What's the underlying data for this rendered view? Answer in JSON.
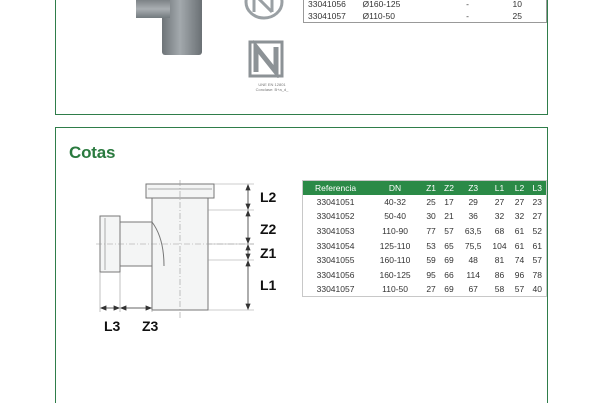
{
  "top_table": {
    "rows": [
      {
        "ref": "33041056",
        "dn": "Ø160-125",
        "col3": "-",
        "col4": "10"
      },
      {
        "ref": "33041057",
        "dn": "Ø110-50",
        "col3": "-",
        "col4": "25"
      }
    ]
  },
  "certification": {
    "caption_line1": "UNE EN 12801",
    "caption_line2": "Conclase: B+a_d_"
  },
  "cotas": {
    "title": "Cotas",
    "drawing_labels": {
      "l2": "L2",
      "z2": "Z2",
      "z1": "Z1",
      "l1": "L1",
      "l3": "L3",
      "z3": "Z3"
    },
    "table": {
      "headers": [
        "Referencia",
        "DN",
        "Z1",
        "Z2",
        "Z3",
        "L1",
        "L2",
        "L3"
      ],
      "rows": [
        [
          "33041051",
          "40-32",
          "25",
          "17",
          "29",
          "27",
          "27",
          "23"
        ],
        [
          "33041052",
          "50-40",
          "30",
          "21",
          "36",
          "32",
          "32",
          "27"
        ],
        [
          "33041053",
          "110-90",
          "77",
          "57",
          "63,5",
          "68",
          "61",
          "52"
        ],
        [
          "33041054",
          "125-110",
          "53",
          "65",
          "75,5",
          "104",
          "61",
          "61"
        ],
        [
          "33041055",
          "160-110",
          "59",
          "69",
          "48",
          "81",
          "74",
          "57"
        ],
        [
          "33041056",
          "160-125",
          "95",
          "66",
          "114",
          "86",
          "96",
          "78"
        ],
        [
          "33041057",
          "110-50",
          "27",
          "69",
          "67",
          "58",
          "57",
          "40"
        ]
      ]
    }
  },
  "colors": {
    "accent_green": "#2b8a47",
    "title_green": "#2a7a3f",
    "pipe_grey": "#8f9599"
  }
}
